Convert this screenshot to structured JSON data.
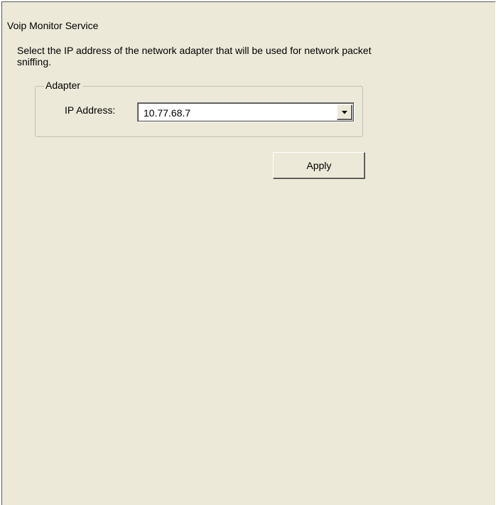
{
  "service": {
    "title": "Voip Monitor Service",
    "description": "Select the IP address of the network adapter that will be used for network packet sniffing."
  },
  "adapter": {
    "legend": "Adapter",
    "ip_label": "IP Address:",
    "ip_value": "10.77.68.7",
    "dropdown_icon": "chevron-down-icon"
  },
  "actions": {
    "apply_label": "Apply"
  },
  "colors": {
    "panel_background": "#ece9d8",
    "field_background": "#ffffff",
    "text": "#000000"
  }
}
